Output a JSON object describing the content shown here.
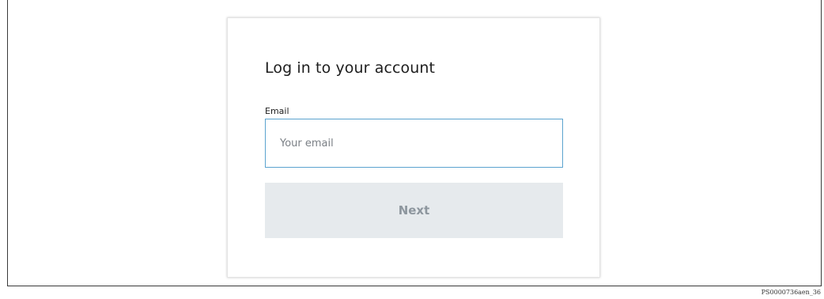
{
  "login": {
    "title": "Log in to your account",
    "email_label": "Email",
    "email_placeholder": "Your email",
    "email_value": "",
    "next_label": "Next"
  },
  "caption": "PS0000736aen_36",
  "colors": {
    "input_focus_border": "#5ba3cf",
    "button_bg": "#e6eaed",
    "button_text": "#8d969e"
  }
}
